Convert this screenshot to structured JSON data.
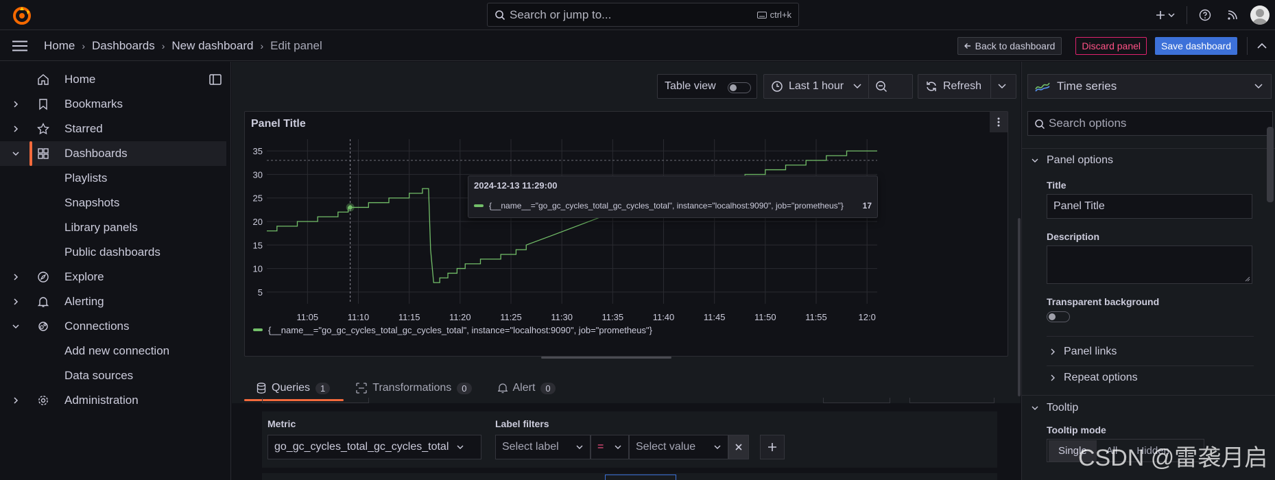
{
  "topbar": {
    "search_placeholder": "Search or jump to...",
    "shortcut": "ctrl+k"
  },
  "breadcrumb": {
    "items": [
      "Home",
      "Dashboards",
      "New dashboard"
    ],
    "current": "Edit panel"
  },
  "actions": {
    "back": "Back to dashboard",
    "discard": "Discard panel",
    "save": "Save dashboard"
  },
  "sidebar": {
    "items": [
      {
        "label": "Home",
        "icon": "home-icon"
      },
      {
        "label": "Bookmarks",
        "icon": "bookmark-icon"
      },
      {
        "label": "Starred",
        "icon": "star-icon"
      },
      {
        "label": "Dashboards",
        "icon": "apps-icon"
      },
      {
        "label": "Playlists"
      },
      {
        "label": "Snapshots"
      },
      {
        "label": "Library panels"
      },
      {
        "label": "Public dashboards"
      },
      {
        "label": "Explore",
        "icon": "compass-icon"
      },
      {
        "label": "Alerting",
        "icon": "bell-icon"
      },
      {
        "label": "Connections",
        "icon": "connections-icon"
      },
      {
        "label": "Add new connection"
      },
      {
        "label": "Data sources"
      },
      {
        "label": "Administration",
        "icon": "cog-icon"
      }
    ]
  },
  "toolbar": {
    "table_view": "Table view",
    "time_range": "Last 1 hour",
    "refresh": "Refresh"
  },
  "panel": {
    "title": "Panel Title",
    "legend": "{__name__=\"go_gc_cycles_total_gc_cycles_total\", instance=\"localhost:9090\", job=\"prometheus\"}",
    "tooltip": {
      "time": "2024-12-13 11:29:00",
      "series": "{__name__=\"go_gc_cycles_total_gc_cycles_total\", instance=\"localhost:9090\", job=\"prometheus\"}",
      "value": "17"
    }
  },
  "chart_data": {
    "type": "line",
    "x_ticks": [
      "11:05",
      "11:10",
      "11:15",
      "11:20",
      "11:25",
      "11:30",
      "11:35",
      "11:40",
      "11:45",
      "11:50",
      "11:55",
      "12:0"
    ],
    "y_ticks": [
      5,
      10,
      15,
      20,
      25,
      30,
      35
    ],
    "ylim": [
      2.5,
      37.5
    ],
    "xlim_minutes": [
      1,
      61
    ],
    "grid": true,
    "line_color": "#73bf69",
    "series": [
      {
        "name": "{__name__=\"go_gc_cycles_total_gc_cycles_total\", instance=\"localhost:9090\", job=\"prometheus\"}",
        "points": [
          [
            1,
            18
          ],
          [
            2,
            19
          ],
          [
            4,
            20
          ],
          [
            6,
            21
          ],
          [
            8,
            22
          ],
          [
            9,
            23
          ],
          [
            11,
            24
          ],
          [
            13,
            25
          ],
          [
            15,
            26
          ],
          [
            16.3,
            27
          ],
          [
            16.9,
            27
          ],
          [
            17.1,
            14
          ],
          [
            17.4,
            7
          ],
          [
            18,
            8
          ],
          [
            18.8,
            9
          ],
          [
            19.7,
            10
          ],
          [
            20.5,
            11
          ],
          [
            22,
            12
          ],
          [
            24,
            13
          ],
          [
            25.5,
            14
          ],
          [
            26.5,
            15
          ],
          [
            29,
            17
          ],
          [
            40,
            26
          ],
          [
            42,
            27
          ],
          [
            44,
            28
          ],
          [
            46,
            29
          ],
          [
            48,
            30
          ],
          [
            50,
            31
          ],
          [
            52,
            32
          ],
          [
            54,
            33
          ],
          [
            56,
            34
          ],
          [
            58,
            35
          ],
          [
            61,
            35
          ]
        ]
      }
    ],
    "hover_x": 9.2
  },
  "tabs": [
    {
      "label": "Queries",
      "count": "1",
      "icon": "database-icon"
    },
    {
      "label": "Transformations",
      "count": "0",
      "icon": "transform-icon"
    },
    {
      "label": "Alert",
      "count": "0",
      "icon": "bell-icon"
    }
  ],
  "query": {
    "metric_label": "Metric",
    "metric_value": "go_gc_cycles_total_gc_cycles_total",
    "filters_label": "Label filters",
    "select_label": "Select label",
    "operator": "=",
    "select_value": "Select value"
  },
  "options": {
    "viz_type": "Time series",
    "search_placeholder": "Search options",
    "panel_options": "Panel options",
    "title_label": "Title",
    "title_value": "Panel Title",
    "description_label": "Description",
    "transparent_label": "Transparent background",
    "panel_links": "Panel links",
    "repeat_options": "Repeat options",
    "tooltip_section": "Tooltip",
    "tooltip_mode_label": "Tooltip mode",
    "tooltip_mode_options": [
      "Single",
      "All",
      "Hidden"
    ]
  },
  "watermark": "CSDN @雷袭月启",
  "colors": {
    "accent": "#f36a3c",
    "primary": "#3d71d9",
    "danger": "#ff5286",
    "series": "#73bf69"
  }
}
